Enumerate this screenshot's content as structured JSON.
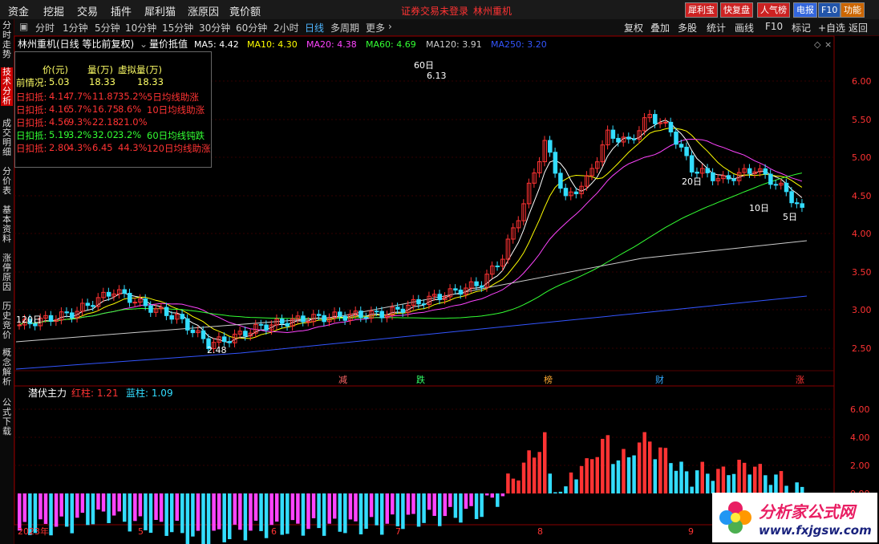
{
  "menu": {
    "items": [
      "资金",
      "挖掘",
      "交易",
      "插件",
      "犀利猫",
      "涨原因",
      "竟价额"
    ],
    "status": "证券交易未登录",
    "stock": "林州重机",
    "right_buttons": [
      "犀利宝",
      "快复盘",
      "人气榜",
      "电报",
      "F10",
      "功能"
    ]
  },
  "toolbar": {
    "periods": [
      "分时",
      "1分钟",
      "5分钟",
      "10分钟",
      "15分钟",
      "30分钟",
      "60分钟",
      "2小时",
      "日线",
      "多周期",
      "更多"
    ],
    "active": "日线",
    "right": [
      "复权",
      "叠加",
      "多股",
      "统计",
      "画线",
      "F10",
      "标记",
      "+自选",
      "返回"
    ]
  },
  "left_tabs": [
    "分时走势",
    "技术分析",
    "成交明细",
    "分价表",
    "基本资料",
    "涨停原因",
    "历史竞价",
    "概念解析",
    "公式下载"
  ],
  "left_active": "技术分析",
  "main": {
    "title": "林州重机(日线 等比前复权)",
    "indicator": "量价抵值",
    "ma": [
      {
        "label": "MA5: 4.42",
        "color": "#ffffff"
      },
      {
        "label": "MA10: 4.30",
        "color": "#ffff00"
      },
      {
        "label": "MA20: 4.38",
        "color": "#ff44ff"
      },
      {
        "label": "MA60: 4.69",
        "color": "#33ff33"
      },
      {
        "label": "MA120: 3.91",
        "color": "#cccccc"
      },
      {
        "label": "MA250: 3.20",
        "color": "#3355ff"
      }
    ],
    "price_axis": [
      "6.00",
      "5.50",
      "5.00",
      "4.50",
      "4.00",
      "3.50",
      "3.00",
      "2.50"
    ],
    "annotations": {
      "high": "6.13",
      "high_label": "60日",
      "low": "2.48",
      "label_120": "120日",
      "label_20": "20日",
      "label_10": "10日",
      "label_5": "5日"
    },
    "event_markers": [
      "减",
      "跌",
      "榜",
      "财",
      "涨"
    ]
  },
  "infobox": {
    "header": [
      "价(元)",
      "量(万)",
      "虚拟量(万)"
    ],
    "prev": {
      "label": "前情况:",
      "price": "5.03",
      "vol": "18.33",
      "vvol": "18.33"
    },
    "rows": [
      {
        "label": "日扣抵:",
        "text": "4.14",
        "t2": "7.7%",
        "t3": "11.87",
        "t4": "35.2%",
        "note": "5日均线助涨",
        "color": "#ff3333"
      },
      {
        "label": "日扣抵:",
        "text": "4.16",
        "t2": "5.7%",
        "t3": "16.75",
        "t4": "8.6%",
        "note": "10日均线助涨",
        "color": "#ff3333"
      },
      {
        "label": "日扣抵:",
        "text": "4.56",
        "t2": "9.3%",
        "t3": "22.18",
        "t4": "21.0%",
        "note": "",
        "color": "#ff3333"
      },
      {
        "label": "日扣抵:",
        "text": "5.19",
        "t2": "3.2%",
        "t3": "32.02",
        "t4": "3.2%",
        "note": "60日均线钝跌",
        "color": "#33ff33"
      },
      {
        "label": "日扣抵:",
        "text": "2.80",
        "t2": "4.3%",
        "t3": "6.45",
        "t4": "44.3%",
        "note": "120日均线助涨",
        "color": "#ff3333"
      }
    ]
  },
  "sub": {
    "title": "潜伏主力",
    "red_label": "红柱: 1.21",
    "blue_label": "蓝柱: 1.09",
    "axis": [
      "6.00",
      "4.00",
      "2.00",
      "0.00"
    ]
  },
  "dates": [
    "2023年",
    "5",
    "6",
    "7",
    "8",
    "9"
  ],
  "watermark_text": "分析家公式网",
  "watermark_url": "www.fxjgsw.com",
  "colors": {
    "up": "#ff3333",
    "down": "#33ddff",
    "bg": "#000000",
    "grid": "#550000"
  }
}
